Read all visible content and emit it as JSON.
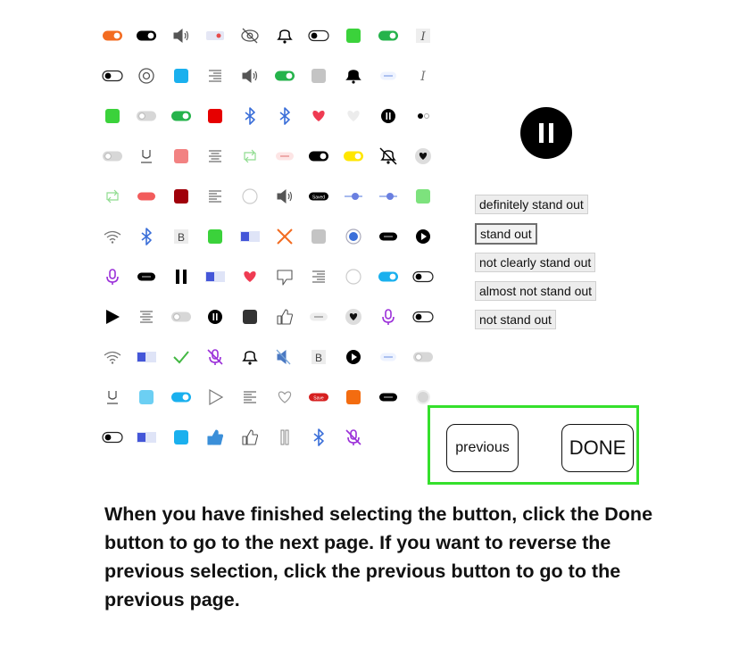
{
  "icon_grid": [
    [
      "toggle-switch-orange-on-icon",
      "toggle-switch-black-on-icon",
      "speaker-volume-icon",
      "pill-switch-icon",
      "eye-slash-icon",
      "bell-outline-icon",
      "toggle-switch-off-icon",
      "green-square-icon",
      "toggle-switch-green-on-icon",
      "italic-icon"
    ],
    [
      "toggle-switch-off-icon",
      "eye-icon",
      "blue-square-icon",
      "align-right-icon",
      "speaker-volume-icon",
      "toggle-switch-green-on-icon",
      "gray-square-icon",
      "bell-filled-icon",
      "blue-text-button-icon",
      "text-cursor-icon"
    ],
    [
      "green-square-icon",
      "toggle-switch-gray-icon",
      "toggle-switch-green-on-icon",
      "red-square-icon",
      "bluetooth-icon",
      "bluetooth-icon",
      "heart-red-icon",
      "heart-light-icon",
      "pause-circle-icon",
      "radio-dots-icon"
    ],
    [
      "toggle-switch-gray-icon",
      "underline-icon",
      "pink-square-icon",
      "align-center-icon",
      "repeat-arrows-icon",
      "pink-button-icon",
      "toggle-switch-black-on-icon",
      "toggle-switch-yellow-on-icon",
      "bell-off-icon",
      "heart-in-circle-icon"
    ],
    [
      "repeat-arrows-icon",
      "red-button-icon",
      "dark-red-square-icon",
      "align-left-icon",
      "circle-outline-icon",
      "speaker-volume-icon",
      "saved-button-icon",
      "slider-icon",
      "slider-icon",
      "light-green-square-icon"
    ],
    [
      "wifi-icon",
      "bluetooth-icon",
      "bold-icon",
      "green-square-icon",
      "blue-segment-switch-icon",
      "close-x-icon",
      "gray-square-icon",
      "radio-filled-icon",
      "black-text-button-icon",
      "play-circle-icon"
    ],
    [
      "microphone-icon",
      "black-text-button-icon",
      "pause-icon",
      "blue-segment-switch-icon",
      "heart-red-icon",
      "thumbs-down-icon",
      "align-right-icon",
      "circle-outline-icon",
      "toggle-switch-blue-icon",
      "toggle-switch-off-icon"
    ],
    [
      "play-icon",
      "align-center-icon",
      "toggle-switch-gray-icon",
      "pause-circle-icon",
      "black-square-icon",
      "thumbs-up-icon",
      "gray-text-button-icon",
      "heart-in-circle-icon",
      "microphone-icon",
      "toggle-switch-off-icon"
    ],
    [
      "wifi-icon",
      "blue-segment-switch-icon",
      "check-icon",
      "microphone-off-icon",
      "bell-outline-icon",
      "speaker-muted-icon",
      "bold-icon",
      "play-circle-icon",
      "blue-text-button-icon",
      "toggle-switch-gray-icon"
    ],
    [
      "underline-icon",
      "light-blue-square-icon",
      "toggle-switch-blue-icon",
      "play-outline-icon",
      "align-left-icon",
      "heart-outline-icon",
      "save-button-icon",
      "orange-square-icon",
      "black-text-button-icon",
      "radio-gray-icon"
    ],
    [
      "toggle-switch-off-icon",
      "blue-segment-switch-icon",
      "blue-square-icon",
      "thumbs-up-filled-icon",
      "thumbs-up-icon",
      "pause-outline-icon",
      "bluetooth-icon",
      "microphone-off-icon"
    ]
  ],
  "colors": {
    "nav_border": "#35e02c",
    "accent_green": "#22c55e",
    "accent_blue": "#1ab0ee",
    "accent_red": "#e60000",
    "accent_orange": "#f36c21"
  },
  "tiny_button_labels": {
    "saved": "Saved",
    "save": "Save"
  },
  "choices": [
    {
      "label": "definitely stand out",
      "selected": false
    },
    {
      "label": "stand out",
      "selected": true
    },
    {
      "label": "not clearly stand out",
      "selected": false
    },
    {
      "label": "almost not stand out",
      "selected": false
    },
    {
      "label": "not stand out",
      "selected": false
    }
  ],
  "nav": {
    "previous_label": "previous",
    "done_label": "DONE"
  },
  "instructions": "When you have finished selecting the button, click the Done button to go to the next page. If you want to reverse the previous selection, click the previous button to go to the previous page."
}
